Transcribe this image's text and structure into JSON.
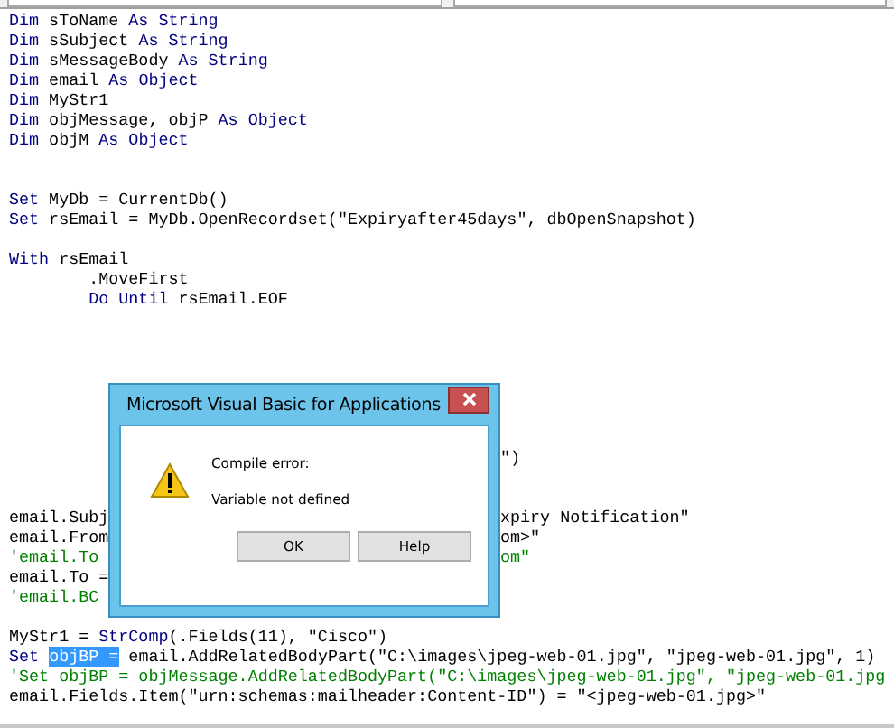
{
  "editor": {
    "lines": [
      {
        "kind": "code",
        "tokens": [
          {
            "kind": "keyword",
            "text": "Dim"
          },
          {
            "kind": "text",
            "text": " sToName "
          },
          {
            "kind": "keyword",
            "text": "As String"
          }
        ]
      },
      {
        "kind": "code",
        "tokens": [
          {
            "kind": "keyword",
            "text": "Dim"
          },
          {
            "kind": "text",
            "text": " sSubject "
          },
          {
            "kind": "keyword",
            "text": "As String"
          }
        ]
      },
      {
        "kind": "code",
        "tokens": [
          {
            "kind": "keyword",
            "text": "Dim"
          },
          {
            "kind": "text",
            "text": " sMessageBody "
          },
          {
            "kind": "keyword",
            "text": "As String"
          }
        ]
      },
      {
        "kind": "code",
        "tokens": [
          {
            "kind": "keyword",
            "text": "Dim"
          },
          {
            "kind": "text",
            "text": " email "
          },
          {
            "kind": "keyword",
            "text": "As Object"
          }
        ]
      },
      {
        "kind": "code",
        "tokens": [
          {
            "kind": "keyword",
            "text": "Dim"
          },
          {
            "kind": "text",
            "text": " MyStr1"
          }
        ]
      },
      {
        "kind": "code",
        "tokens": [
          {
            "kind": "keyword",
            "text": "Dim"
          },
          {
            "kind": "text",
            "text": " objMessage, objP "
          },
          {
            "kind": "keyword",
            "text": "As Object"
          }
        ]
      },
      {
        "kind": "code",
        "tokens": [
          {
            "kind": "keyword",
            "text": "Dim"
          },
          {
            "kind": "text",
            "text": " objM "
          },
          {
            "kind": "keyword",
            "text": "As Object"
          }
        ]
      },
      {
        "kind": "blank"
      },
      {
        "kind": "blank"
      },
      {
        "kind": "code",
        "tokens": [
          {
            "kind": "keyword",
            "text": "Set"
          },
          {
            "kind": "text",
            "text": " MyDb = CurrentDb()"
          }
        ]
      },
      {
        "kind": "code",
        "tokens": [
          {
            "kind": "keyword",
            "text": "Set"
          },
          {
            "kind": "text",
            "text": " rsEmail = MyDb.OpenRecordset(\"Expiryafter45days\", dbOpenSnapshot)"
          }
        ]
      },
      {
        "kind": "blank"
      },
      {
        "kind": "code",
        "tokens": [
          {
            "kind": "keyword",
            "text": "With"
          },
          {
            "kind": "text",
            "text": " rsEmail"
          }
        ]
      },
      {
        "kind": "code",
        "tokens": [
          {
            "kind": "text",
            "text": "        .MoveFirst"
          }
        ]
      },
      {
        "kind": "code",
        "tokens": [
          {
            "kind": "keyword",
            "text": "        Do Until"
          },
          {
            "kind": "text",
            "text": " rsEmail.EOF"
          }
        ]
      },
      {
        "kind": "blank"
      },
      {
        "kind": "blank"
      },
      {
        "kind": "blank"
      },
      {
        "kind": "blank"
      },
      {
        "kind": "blank"
      },
      {
        "kind": "blank"
      },
      {
        "kind": "blank"
      },
      {
        "kind": "split",
        "right": [
          {
            "kind": "text",
            "text": "\")"
          }
        ]
      },
      {
        "kind": "blank"
      },
      {
        "kind": "blank"
      },
      {
        "kind": "split",
        "left": [
          {
            "kind": "text",
            "text": "email.Subj"
          }
        ],
        "right": [
          {
            "kind": "text",
            "text": "xpiry Notification\""
          }
        ]
      },
      {
        "kind": "split",
        "left": [
          {
            "kind": "text",
            "text": "email.From"
          }
        ],
        "right": [
          {
            "kind": "text",
            "text": "om>\""
          }
        ]
      },
      {
        "kind": "split",
        "left": [
          {
            "kind": "comment",
            "text": "'email.To"
          }
        ],
        "right": [
          {
            "kind": "comment",
            "text": "om\""
          }
        ]
      },
      {
        "kind": "split",
        "left": [
          {
            "kind": "text",
            "text": "email.To ="
          }
        ]
      },
      {
        "kind": "split",
        "left": [
          {
            "kind": "comment",
            "text": "'email.BC"
          }
        ]
      },
      {
        "kind": "blank"
      },
      {
        "kind": "code",
        "tokens": [
          {
            "kind": "text",
            "text": "MyStr1 = "
          },
          {
            "kind": "keyword",
            "text": "StrComp"
          },
          {
            "kind": "text",
            "text": "(.Fields(11), \"Cisco\")"
          }
        ]
      },
      {
        "kind": "code",
        "tokens": [
          {
            "kind": "keyword",
            "text": "Set "
          },
          {
            "kind": "text",
            "text": "objBP =",
            "selected": true
          },
          {
            "kind": "text",
            "text": " email.AddRelatedBodyPart(\"C:\\images\\jpeg-web-01.jpg\", \"jpeg-web-01.jpg\", 1)"
          }
        ]
      },
      {
        "kind": "code",
        "tokens": [
          {
            "kind": "comment",
            "text": "'Set objBP = objMessage.AddRelatedBodyPart(\"C:\\images\\jpeg-web-01.jpg\", \"jpeg-web-01.jpg"
          }
        ]
      },
      {
        "kind": "code",
        "tokens": [
          {
            "kind": "text",
            "text": "email.Fields.Item(\"urn:schemas:mailheader:Content-ID\") = \"<jpeg-web-01.jpg>\""
          }
        ]
      }
    ]
  },
  "dialog": {
    "title": "Microsoft Visual Basic for Applications",
    "heading": "Compile error:",
    "message": "Variable not defined",
    "buttons": [
      "OK",
      "Help"
    ]
  }
}
